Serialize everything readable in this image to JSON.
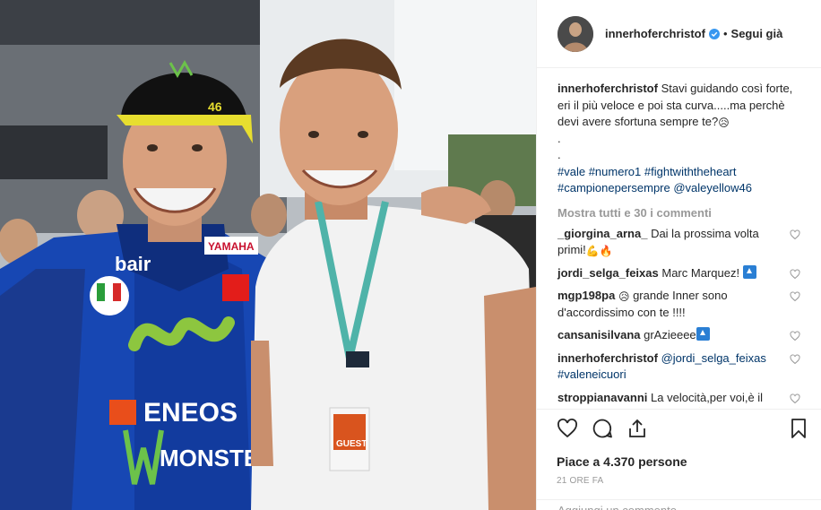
{
  "post": {
    "username": "innerhoferchristof",
    "follow_status": "Segui già",
    "separator": "•",
    "caption": {
      "text": "Stavi guidando così forte, eri il più veloce e poi sta curva.....ma perchè devi avere sfortuna sempre te?",
      "dot1": ".",
      "dot2": ".",
      "hashtags": [
        "#vale",
        "#numero1",
        "#fightwiththeheart",
        "#campionepersempre"
      ],
      "mention": "@valeyellow46"
    },
    "view_all_comments": "Mostra tutti e 30 i commenti",
    "comments": [
      {
        "user": "_giorgina_arna_",
        "text": "Dai la prossima volta primi!",
        "emoji": "💪🔥"
      },
      {
        "user": "jordi_selga_feixas",
        "text": "Marc Marquez!",
        "emoji_name": "top-arrow-emoji"
      },
      {
        "user": "mgp198pa",
        "emoji": "😥",
        "text": "grande Inner sono d'accordissimo con te !!!!"
      },
      {
        "user": "cansanisilvana",
        "text": "grAzieeee",
        "emoji_name": "top-arrow-emoji"
      },
      {
        "user": "innerhoferchristof",
        "mention": "@jordi_selga_feixas",
        "hashtag": "#valeneicuori"
      },
      {
        "user": "stroppianavanni",
        "text": "La velocità,per voi,è il vs comune denominatore 👍!!!!!!"
      }
    ],
    "likes_text": "Piace a 4.370 persone",
    "time_ago": "21 ORE FA",
    "add_comment_placeholder": "Aggiungi un commento..."
  },
  "colors": {
    "link": "#003569",
    "verified": "#3897f0",
    "muted": "#999999",
    "text": "#262626",
    "border": "#efefef"
  },
  "icons": [
    "heart-icon",
    "comment-icon",
    "share-icon",
    "bookmark-icon",
    "verified-badge-icon",
    "small-heart-icon"
  ]
}
